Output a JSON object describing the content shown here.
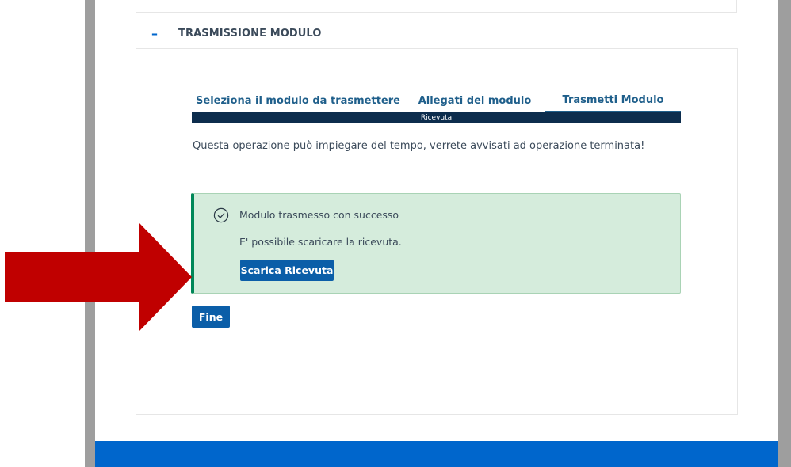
{
  "section": {
    "toggle_symbol": "–",
    "title": "TRASMISSIONE MODULO"
  },
  "tabs": [
    {
      "label": "Seleziona il modulo da trasmettere"
    },
    {
      "label": "Allegati del modulo"
    },
    {
      "label": "Trasmetti Modulo"
    }
  ],
  "progress": {
    "label": "Ricevuta",
    "value": 1.0
  },
  "notice": "Questa operazione può impiegare del tempo, verrete avvisati ad operazione terminata!",
  "alert": {
    "title": "Modulo trasmesso con successo",
    "message": "E' possibile scaricare la ricevuta.",
    "download_label": "Scarica Ricevuta"
  },
  "finish_label": "Fine",
  "colors": {
    "primary": "#0b5ea8",
    "success": "#008758",
    "success_bg": "#d5ecdc",
    "progress_bar": "#0d2d4d",
    "arrow": "#c00000",
    "footer": "#0066cc"
  },
  "icons": {
    "success": "check-circle-icon",
    "annotation": "red-arrow-icon",
    "toggle": "minus-icon"
  }
}
